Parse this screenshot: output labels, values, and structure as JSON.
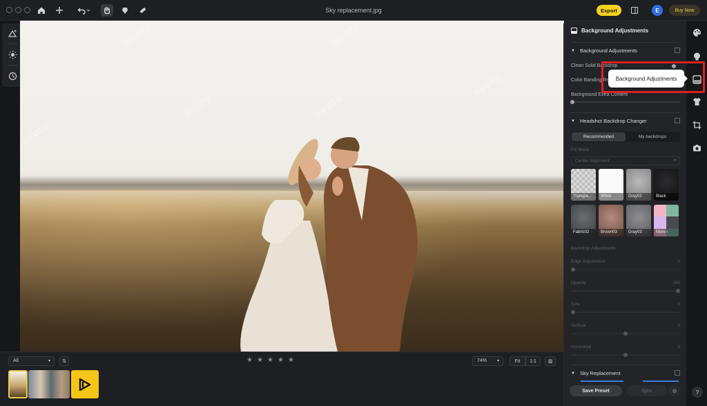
{
  "window": {
    "title": "Sky replacement.jpg"
  },
  "topbar": {
    "export_label": "Export",
    "avatar_letter": "E",
    "buy_now_label": "Buy Now"
  },
  "canvas": {
    "watermark": "evoto"
  },
  "filmstrip": {
    "filter_value": "All",
    "rating_stars": [
      "★",
      "★",
      "★",
      "★",
      "★"
    ],
    "zoom_value": "74%",
    "fit_label": "Fit",
    "actual_label": "1:1"
  },
  "panel": {
    "title": "Background Adjustments",
    "section1": {
      "title": "Background Adjustments",
      "rows": [
        {
          "label": "Clean Solid Backdrop"
        },
        {
          "label": "Color Banding Re"
        },
        {
          "label": "Background Extra Content"
        }
      ]
    },
    "section2": {
      "title": "Headshot Backdrop Changer",
      "tabs": [
        "Recommended",
        "My backdrops"
      ],
      "fill_mode_label": "Fill Mode",
      "fill_mode_value": "Center Alignment",
      "tiles": [
        {
          "label": "Transpa..."
        },
        {
          "label": "White"
        },
        {
          "label": "Gray02"
        },
        {
          "label": "Black"
        },
        {
          "label": "Fabric02"
        },
        {
          "label": "Brown03"
        },
        {
          "label": "Gray03"
        },
        {
          "label": "More ›"
        }
      ],
      "backdrop_adjustments_label": "Backdrop Adjustments",
      "sliders": [
        {
          "label": "Edge Adjustment",
          "value": "0",
          "fraction": 0
        },
        {
          "label": "Opacity",
          "value": "100",
          "fraction": 1.0
        },
        {
          "label": "Size",
          "value": "0",
          "fraction": 0
        },
        {
          "label": "Vertical",
          "value": "0",
          "fraction": 0.5
        },
        {
          "label": "Horizontal",
          "value": "0",
          "fraction": 0.5
        }
      ]
    },
    "section3": {
      "title": "Sky Replacement"
    },
    "footer": {
      "save_preset_label": "Save Preset",
      "sync_label": "Sync"
    }
  },
  "tooltip": {
    "text": "Background Adjustments"
  },
  "help": {
    "label": "?"
  }
}
